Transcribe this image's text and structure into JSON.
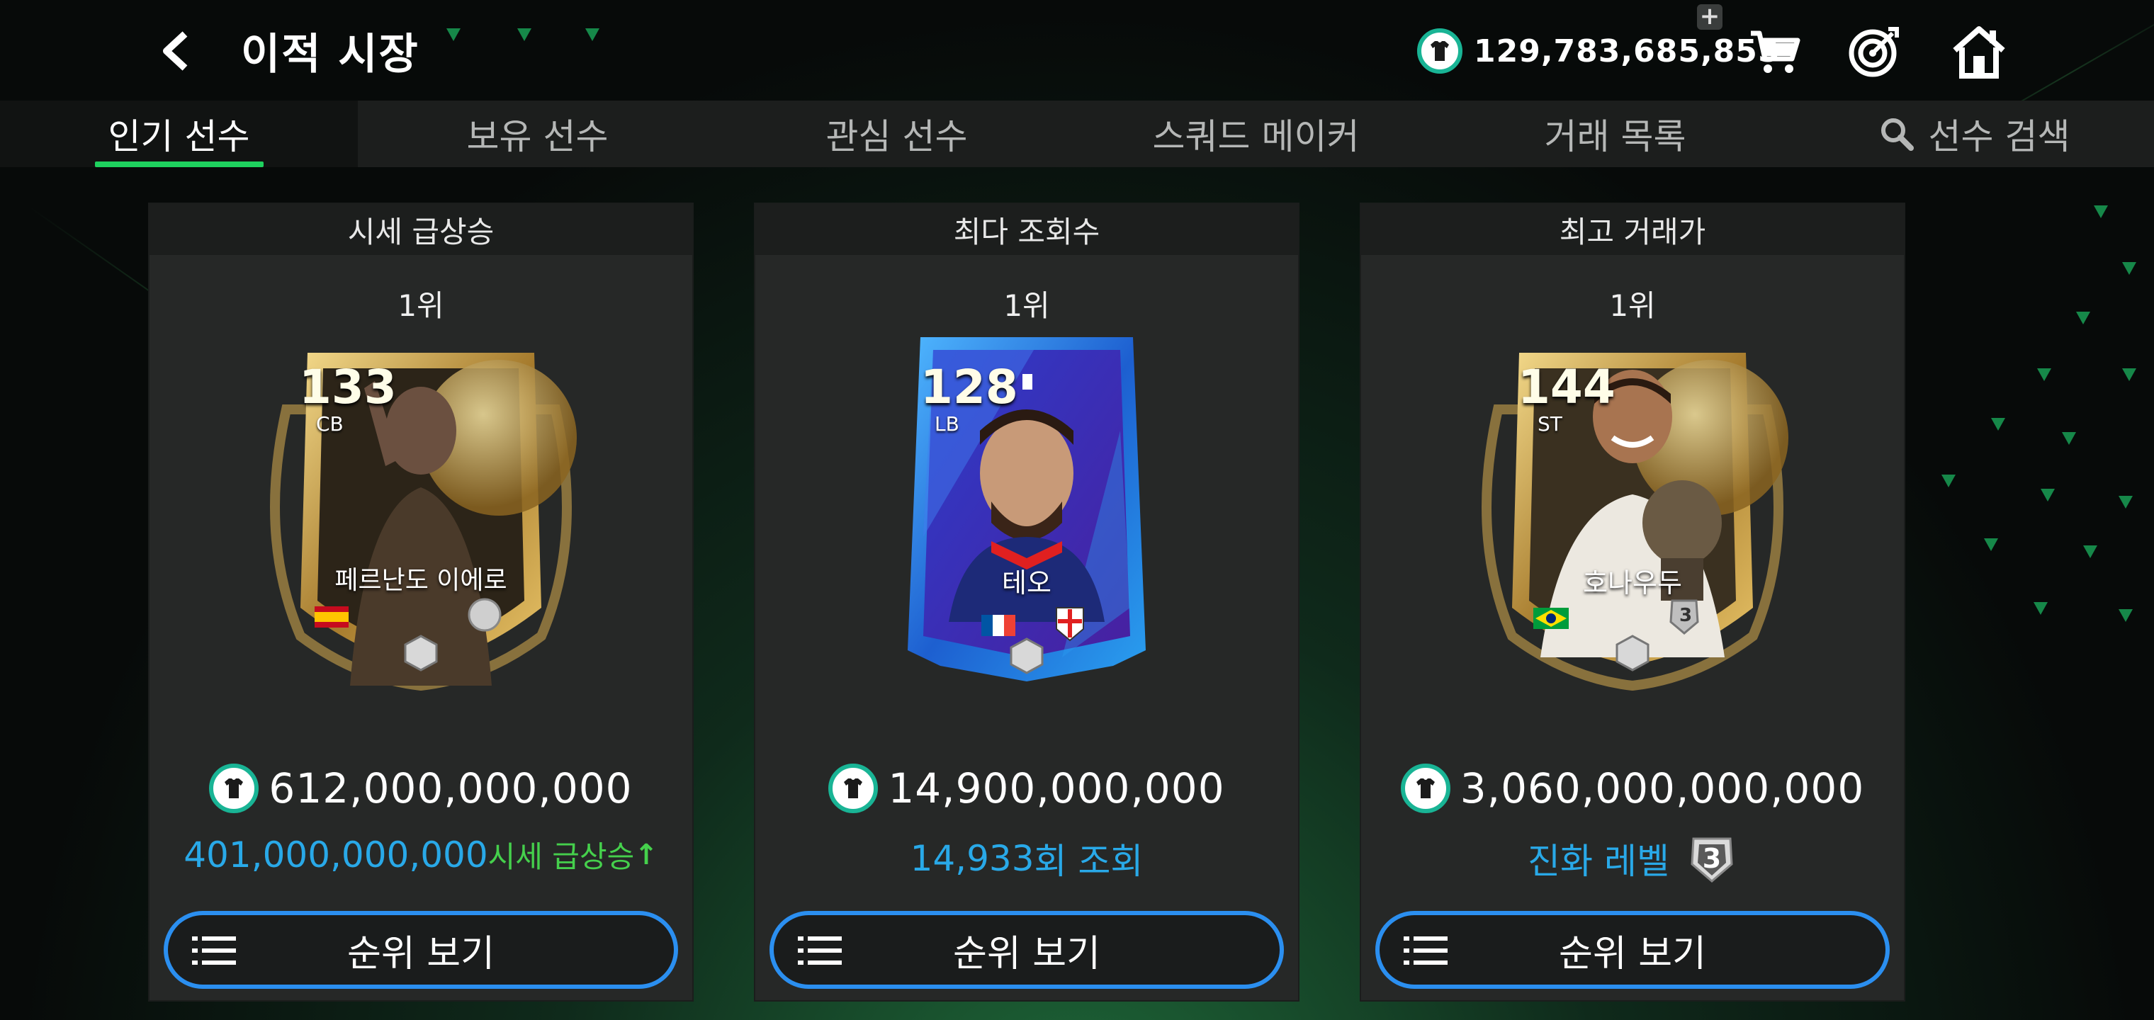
{
  "header": {
    "title": "이적 시장",
    "currency_value": "129,783,685,855",
    "plus_label": "+",
    "icons": [
      "back-icon",
      "coin-icon",
      "cart-icon",
      "target-icon",
      "home-icon"
    ]
  },
  "tabs": [
    {
      "label": "인기 선수",
      "active": true
    },
    {
      "label": "보유 선수",
      "active": false
    },
    {
      "label": "관심 선수",
      "active": false
    },
    {
      "label": "스쿼드 메이커",
      "active": false
    },
    {
      "label": "거래 목록",
      "active": false
    },
    {
      "label": "선수 검색",
      "active": false,
      "icon": "search-icon"
    }
  ],
  "panels": [
    {
      "heading": "시세 급상승",
      "rank": "1위",
      "card": {
        "ovr": "133",
        "position": "CB",
        "name": "페르난도 이에로",
        "nation": "spain-flag"
      },
      "price": "612,000,000,000",
      "sub_value": "401,000,000,000",
      "sub_label": "시세 급상승",
      "sub_arrow": "↑",
      "button": "순위 보기"
    },
    {
      "heading": "최다 조회수",
      "rank": "1위",
      "card": {
        "ovr": "128",
        "position": "LB",
        "name": "테오",
        "nation": "france-flag"
      },
      "price": "14,900,000,000",
      "sub_value": "14,933",
      "sub_label": "회 조회",
      "button": "순위 보기"
    },
    {
      "heading": "최고 거래가",
      "rank": "1위",
      "card": {
        "ovr": "144",
        "position": "ST",
        "name": "호나우두",
        "nation": "brazil-flag",
        "level": "3"
      },
      "price": "3,060,000,000,000",
      "sub_label": "진화 레벨",
      "sub_level": "3",
      "button": "순위 보기"
    }
  ],
  "colors": {
    "accent_green": "#1ed15e",
    "button_border": "#2b8ff0",
    "coin_ring": "#19b495",
    "value_blue": "#29a9e8",
    "rise_green": "#45d04c"
  }
}
